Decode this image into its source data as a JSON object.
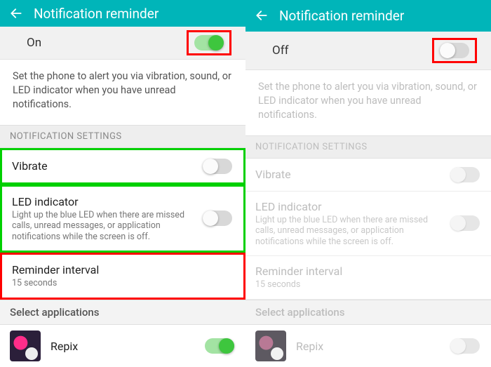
{
  "left": {
    "header_title": "Notification reminder",
    "master_label": "On",
    "master_on": true,
    "description": "Set the phone to alert you via vibration, sound, or LED indicator when you have unread notifications.",
    "section_header": "NOTIFICATION SETTINGS",
    "vibrate_label": "Vibrate",
    "led_label": "LED indicator",
    "led_sub": "Light up the blue LED when there are missed calls, unread messages, or application notifications while the screen is off.",
    "interval_label": "Reminder interval",
    "interval_value": "15 seconds",
    "select_apps": "Select applications",
    "app_name": "Repix"
  },
  "right": {
    "header_title": "Notification reminder",
    "master_label": "Off",
    "master_on": false,
    "description": "Set the phone to alert you via vibration, sound, or LED indicator when you have unread notifications.",
    "section_header": "NOTIFICATION SETTINGS",
    "vibrate_label": "Vibrate",
    "led_label": "LED indicator",
    "led_sub": "Light up the blue LED when there are missed calls, unread messages, or application notifications while the screen is off.",
    "interval_label": "Reminder interval",
    "interval_value": "15 seconds",
    "select_apps": "Select applications",
    "app_name": "Repix"
  }
}
